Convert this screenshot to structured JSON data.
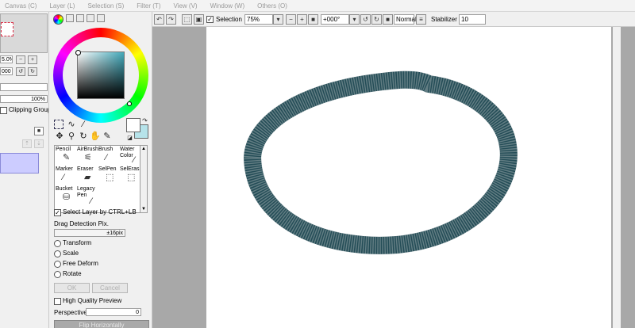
{
  "menu": [
    "Canvas (C)",
    "Layer (L)",
    "Selection (S)",
    "Filter (T)",
    "View (V)",
    "Window (W)",
    "Others (O)"
  ],
  "navigator": {
    "zoom": "5.0%",
    "angle": "000"
  },
  "layer_panel": {
    "opacity": "100%",
    "clipping_group": "Clipping Group"
  },
  "tools": {
    "row1": [
      "Pencil",
      "AirBrush",
      "Brush",
      "Water Color"
    ],
    "row2": [
      "Marker",
      "Eraser",
      "SelPen",
      "SelEras"
    ],
    "row3": [
      "Bucket",
      "Legacy Pen"
    ]
  },
  "options": {
    "select_layer": "Select Layer by CTRL+LB",
    "drag_detection_label": "Drag Detection Pix.",
    "drag_detection_value": "±16pix",
    "transform": "Transform",
    "scale": "Scale",
    "free_deform": "Free Deform",
    "rotate": "Rotate",
    "ok": "OK",
    "cancel": "Cancel",
    "high_quality": "High Quality Preview",
    "perspective": "Perspective",
    "perspective_value": "0",
    "flip": "Flip Horizontally"
  },
  "toolbar": {
    "selection_label": "Selection",
    "zoom": "75%",
    "angle": "+000°",
    "blend": "Normal",
    "stabilizer_label": "Stabilizer",
    "stabilizer_value": "10"
  },
  "colors": {
    "stroke": "#244d57",
    "main_color": "#ffffff",
    "sub_color": "#b6e3ea",
    "layer_selected": "#ccccff"
  }
}
